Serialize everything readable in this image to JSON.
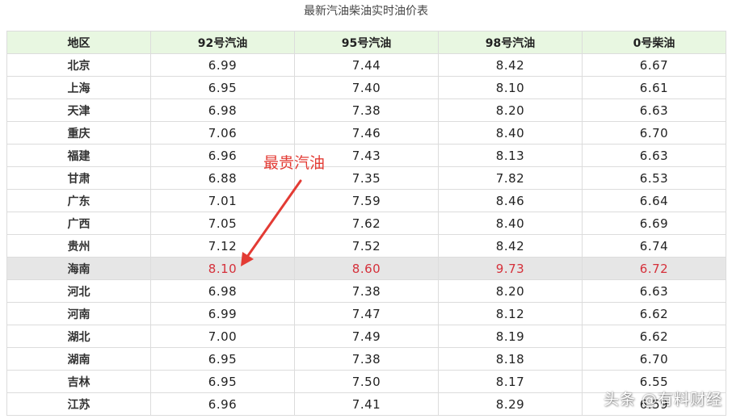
{
  "caption": "最新汽油柴油实时油价表",
  "table": {
    "headers": [
      "地区",
      "92号汽油",
      "95号汽油",
      "98号汽油",
      "0号柴油"
    ],
    "rows": [
      {
        "region": "北京",
        "p92": "6.99",
        "p95": "7.44",
        "p98": "8.42",
        "p0": "6.67"
      },
      {
        "region": "上海",
        "p92": "6.95",
        "p95": "7.40",
        "p98": "8.10",
        "p0": "6.61"
      },
      {
        "region": "天津",
        "p92": "6.98",
        "p95": "7.38",
        "p98": "8.20",
        "p0": "6.63"
      },
      {
        "region": "重庆",
        "p92": "7.06",
        "p95": "7.46",
        "p98": "8.40",
        "p0": "6.70"
      },
      {
        "region": "福建",
        "p92": "6.96",
        "p95": "7.43",
        "p98": "8.13",
        "p0": "6.63"
      },
      {
        "region": "甘肃",
        "p92": "6.88",
        "p95": "7.35",
        "p98": "7.82",
        "p0": "6.53"
      },
      {
        "region": "广东",
        "p92": "7.01",
        "p95": "7.59",
        "p98": "8.46",
        "p0": "6.64"
      },
      {
        "region": "广西",
        "p92": "7.05",
        "p95": "7.62",
        "p98": "8.40",
        "p0": "6.69"
      },
      {
        "region": "贵州",
        "p92": "7.12",
        "p95": "7.52",
        "p98": "8.42",
        "p0": "6.74"
      },
      {
        "region": "海南",
        "p92": "8.10",
        "p95": "8.60",
        "p98": "9.73",
        "p0": "6.72"
      },
      {
        "region": "河北",
        "p92": "6.98",
        "p95": "7.38",
        "p98": "8.20",
        "p0": "6.63"
      },
      {
        "region": "河南",
        "p92": "6.99",
        "p95": "7.47",
        "p98": "8.12",
        "p0": "6.62"
      },
      {
        "region": "湖北",
        "p92": "7.00",
        "p95": "7.49",
        "p98": "8.19",
        "p0": "6.62"
      },
      {
        "region": "湖南",
        "p92": "6.95",
        "p95": "7.38",
        "p98": "8.18",
        "p0": "6.70"
      },
      {
        "region": "吉林",
        "p92": "6.95",
        "p95": "7.50",
        "p98": "8.17",
        "p0": "6.55"
      },
      {
        "region": "江苏",
        "p92": "6.96",
        "p95": "7.41",
        "p98": "8.29",
        "p0": "6.59"
      }
    ],
    "highlight_region": "海南"
  },
  "annotation": {
    "text": "最贵汽油",
    "color": "#e33b34"
  },
  "watermark": "头条 @有料财经",
  "colors": {
    "header_bg": "#e8f7e1",
    "highlight_row_bg": "#e6e6e6",
    "highlight_text": "#d5303a",
    "border": "#dcdcdc"
  }
}
